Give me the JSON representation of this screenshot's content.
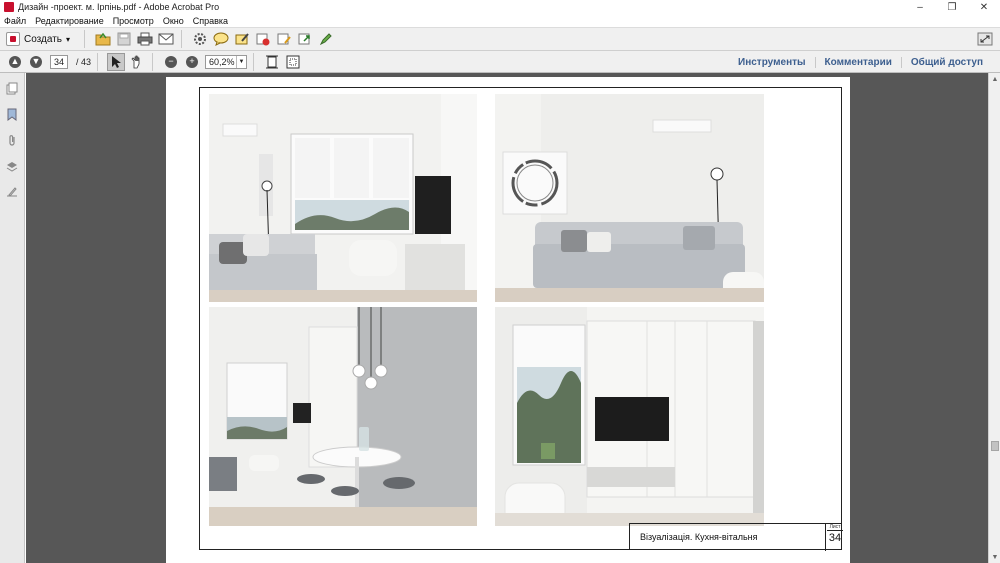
{
  "window": {
    "title": "Дизайн -проект. м. Ірпінь.pdf - Adobe Acrobat Pro",
    "minimize": "–",
    "restore": "❐",
    "close": "✕"
  },
  "menu": [
    "Файл",
    "Редактирование",
    "Просмотр",
    "Окно",
    "Справка"
  ],
  "toolbar": {
    "create_label": "Создать",
    "create_arrow": "▾"
  },
  "navigation": {
    "current_page": "34",
    "total_pages": "/ 43",
    "zoom_value": "60,2%"
  },
  "right_links": {
    "tools": "Инструменты",
    "comments": "Комментарии",
    "share": "Общий доступ"
  },
  "document": {
    "stamp_text": "Візуалізація. Кухня-вітальня",
    "sheet_label": "Лист",
    "sheet_number": "34"
  },
  "scrollbar": {
    "position_fraction": 0.78
  }
}
